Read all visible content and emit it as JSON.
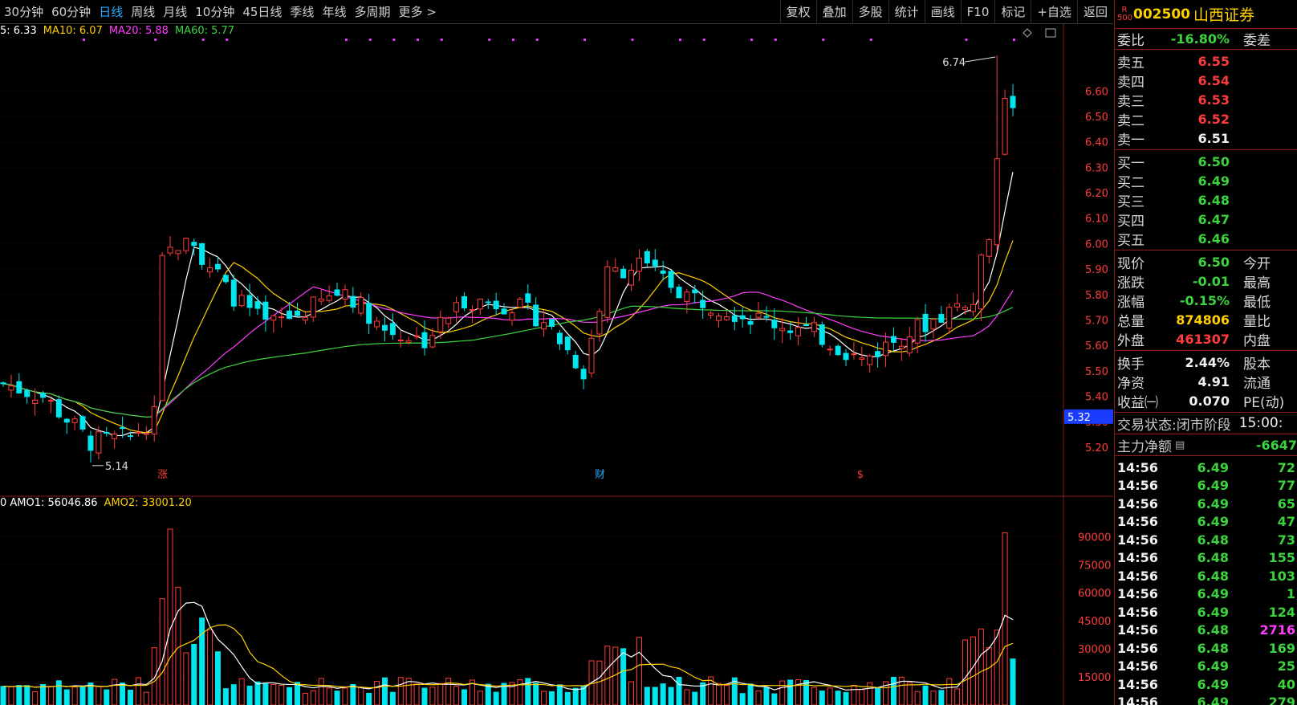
{
  "toolbar": {
    "periods": [
      "30分钟",
      "60分钟",
      "日线",
      "周线",
      "月线",
      "10分钟",
      "45日线",
      "季线",
      "年线",
      "多周期",
      "更多 >"
    ],
    "active_period": "日线",
    "actions": [
      "复权",
      "叠加",
      "多股",
      "统计",
      "画线",
      "F10",
      "标记",
      "+自选",
      "返回"
    ]
  },
  "ma_legend": [
    {
      "text": "5: 6.33",
      "color": "#ffffff"
    },
    {
      "text": "MA10: 6.07",
      "color": "#ffd000"
    },
    {
      "text": "MA20: 5.88",
      "color": "#ff3cff"
    },
    {
      "text": "MA60: 5.77",
      "color": "#3cd43c"
    }
  ],
  "amo_legend": [
    {
      "text": "0  AMO1: 56046.86",
      "color": "#ffffff"
    },
    {
      "text": "AMO2: 33001.20",
      "color": "#ffd000"
    }
  ],
  "chart_data": {
    "type": "candlestick",
    "price_axis": {
      "ticks": [
        "6.60",
        "6.50",
        "6.40",
        "6.30",
        "6.20",
        "6.10",
        "6.00",
        "5.90",
        "5.80",
        "5.70",
        "5.60",
        "5.50",
        "5.40",
        "5.30",
        "5.20"
      ],
      "min": 5.07,
      "max": 6.8
    },
    "current_price_label": "5.32",
    "high_annotation": "6.74",
    "low_annotation": "5.14",
    "event_markers": [
      {
        "label": "涨",
        "color": "#ff3c3c"
      },
      {
        "label": "财",
        "color": "#2aa8ff"
      },
      {
        "label": "$",
        "color": "#ff3c3c"
      }
    ],
    "volume_axis": {
      "ticks": [
        "90000",
        "75000",
        "60000",
        "45000",
        "30000",
        "15000"
      ],
      "max": 97000
    },
    "colors": {
      "up": "#ff3c3c",
      "down": "#00e5ee",
      "ma5": "#ffffff",
      "ma10": "#ffd000",
      "ma20": "#ff3cff",
      "ma60": "#3cd43c",
      "dots": "#e040fb"
    }
  },
  "side": {
    "r_mark": "R\n500",
    "code": "002500",
    "name": "山西证券",
    "weibi_label": "委比",
    "weibi_value": "-16.80%",
    "weicha_label": "委差",
    "asks": [
      {
        "label": "卖五",
        "price": "6.55"
      },
      {
        "label": "卖四",
        "price": "6.54"
      },
      {
        "label": "卖三",
        "price": "6.53"
      },
      {
        "label": "卖二",
        "price": "6.52"
      },
      {
        "label": "卖一",
        "price": "6.51"
      }
    ],
    "bids": [
      {
        "label": "买一",
        "price": "6.50"
      },
      {
        "label": "买二",
        "price": "6.49"
      },
      {
        "label": "买三",
        "price": "6.48"
      },
      {
        "label": "买四",
        "price": "6.47"
      },
      {
        "label": "买五",
        "price": "6.46"
      }
    ],
    "quote": [
      {
        "label": "现价",
        "value": "6.50",
        "label2": "今开",
        "color": "green"
      },
      {
        "label": "涨跌",
        "value": "-0.01",
        "label2": "最高",
        "color": "green"
      },
      {
        "label": "涨幅",
        "value": "-0.15%",
        "label2": "最低",
        "color": "green"
      },
      {
        "label": "总量",
        "value": "874806",
        "label2": "量比",
        "color": "yellow"
      },
      {
        "label": "外盘",
        "value": "461307",
        "label2": "内盘",
        "color": "red"
      }
    ],
    "stats": [
      {
        "label": "换手",
        "value": "2.44%",
        "label2": "股本"
      },
      {
        "label": "净资",
        "value": "4.91",
        "label2": "流通"
      },
      {
        "label": "收益㈠",
        "value": "0.070",
        "label2": "PE(动)"
      }
    ],
    "status_label": "交易状态:",
    "status_value": "闭市阶段",
    "status_time": "15:00:",
    "main_net_label": "主力净额",
    "main_net_value": "-6647",
    "ticks": [
      {
        "time": "14:56",
        "price": "6.49",
        "vol": "72",
        "vcolor": "green"
      },
      {
        "time": "14:56",
        "price": "6.49",
        "vol": "77",
        "vcolor": "green"
      },
      {
        "time": "14:56",
        "price": "6.49",
        "vol": "65",
        "vcolor": "green"
      },
      {
        "time": "14:56",
        "price": "6.49",
        "vol": "47",
        "vcolor": "green"
      },
      {
        "time": "14:56",
        "price": "6.48",
        "vol": "73",
        "vcolor": "green"
      },
      {
        "time": "14:56",
        "price": "6.48",
        "vol": "155",
        "vcolor": "green"
      },
      {
        "time": "14:56",
        "price": "6.48",
        "vol": "103",
        "vcolor": "green"
      },
      {
        "time": "14:56",
        "price": "6.49",
        "vol": "1",
        "vcolor": "green"
      },
      {
        "time": "14:56",
        "price": "6.49",
        "vol": "124",
        "vcolor": "green"
      },
      {
        "time": "14:56",
        "price": "6.48",
        "vol": "2716",
        "vcolor": "magenta"
      },
      {
        "time": "14:56",
        "price": "6.48",
        "vol": "169",
        "vcolor": "green"
      },
      {
        "time": "14:56",
        "price": "6.49",
        "vol": "25",
        "vcolor": "green"
      },
      {
        "time": "14:56",
        "price": "6.49",
        "vol": "40",
        "vcolor": "green"
      },
      {
        "time": "14:56",
        "price": "6.49",
        "vol": "279",
        "vcolor": "green"
      }
    ]
  }
}
